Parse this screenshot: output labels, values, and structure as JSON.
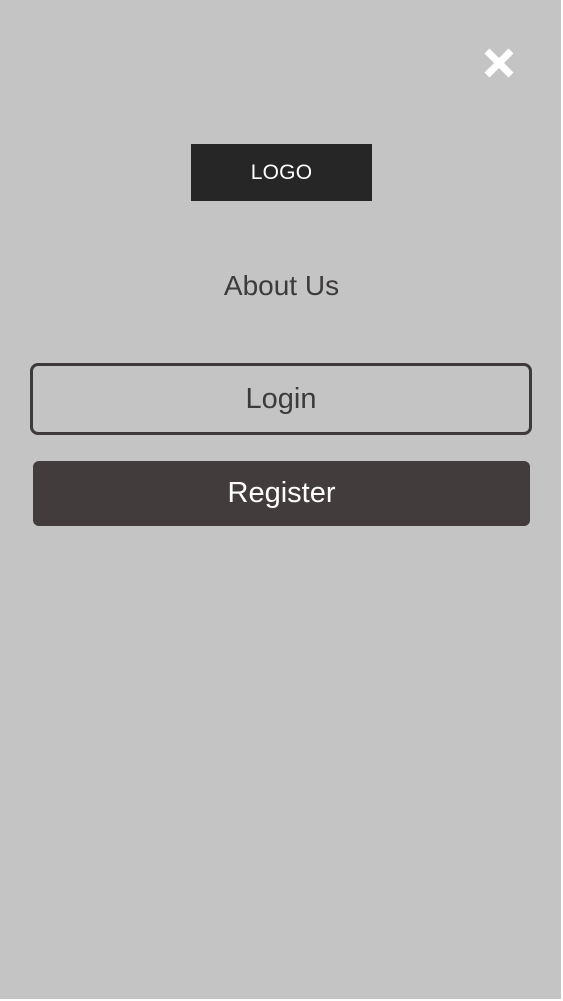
{
  "menu": {
    "close_icon": "close-icon",
    "logo_text": "LOGO",
    "about_label": "About Us",
    "login_label": "Login",
    "register_label": "Register"
  },
  "colors": {
    "background": "#c4c4c4",
    "logo_background": "#262626",
    "text": "#3d3a3a",
    "register_background": "#433c3c",
    "close_icon": "#ffffff"
  }
}
